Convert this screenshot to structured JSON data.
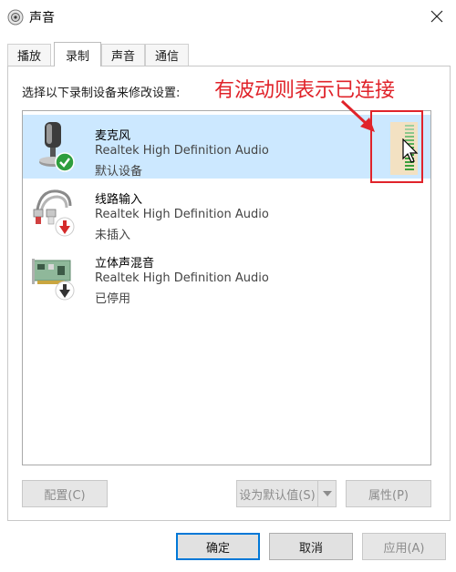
{
  "window": {
    "title": "声音",
    "app_icon": "speaker-icon",
    "close_icon": "close-icon"
  },
  "tabs": [
    {
      "label": "播放",
      "active": false
    },
    {
      "label": "录制",
      "active": true
    },
    {
      "label": "声音",
      "active": false
    },
    {
      "label": "通信",
      "active": false
    }
  ],
  "panel": {
    "instructions": "选择以下录制设备来修改设置:",
    "annotation": "有波动则表示已连接"
  },
  "devices": [
    {
      "name": "麦克风",
      "driver": "Realtek High Definition Audio",
      "status": "默认设备",
      "icon": "microphone-icon",
      "badge": "check-badge-icon",
      "selected": true
    },
    {
      "name": "线路输入",
      "driver": "Realtek High Definition Audio",
      "status": "未插入",
      "icon": "line-in-cable-icon",
      "badge": "red-down-arrow-badge-icon",
      "selected": false
    },
    {
      "name": "立体声混音",
      "driver": "Realtek High Definition Audio",
      "status": "已停用",
      "icon": "sound-card-icon",
      "badge": "disabled-down-arrow-badge-icon",
      "selected": false
    }
  ],
  "panel_buttons": {
    "configure": "配置(C)",
    "set_default": "设为默认值(S)",
    "properties": "属性(P)"
  },
  "dialog_buttons": {
    "ok": "确定",
    "cancel": "取消",
    "apply": "应用(A)"
  },
  "colors": {
    "selection": "#cce8ff",
    "annotation": "#e0232a",
    "level_green": "#3ca03c",
    "check_green": "#2e9e3e"
  }
}
